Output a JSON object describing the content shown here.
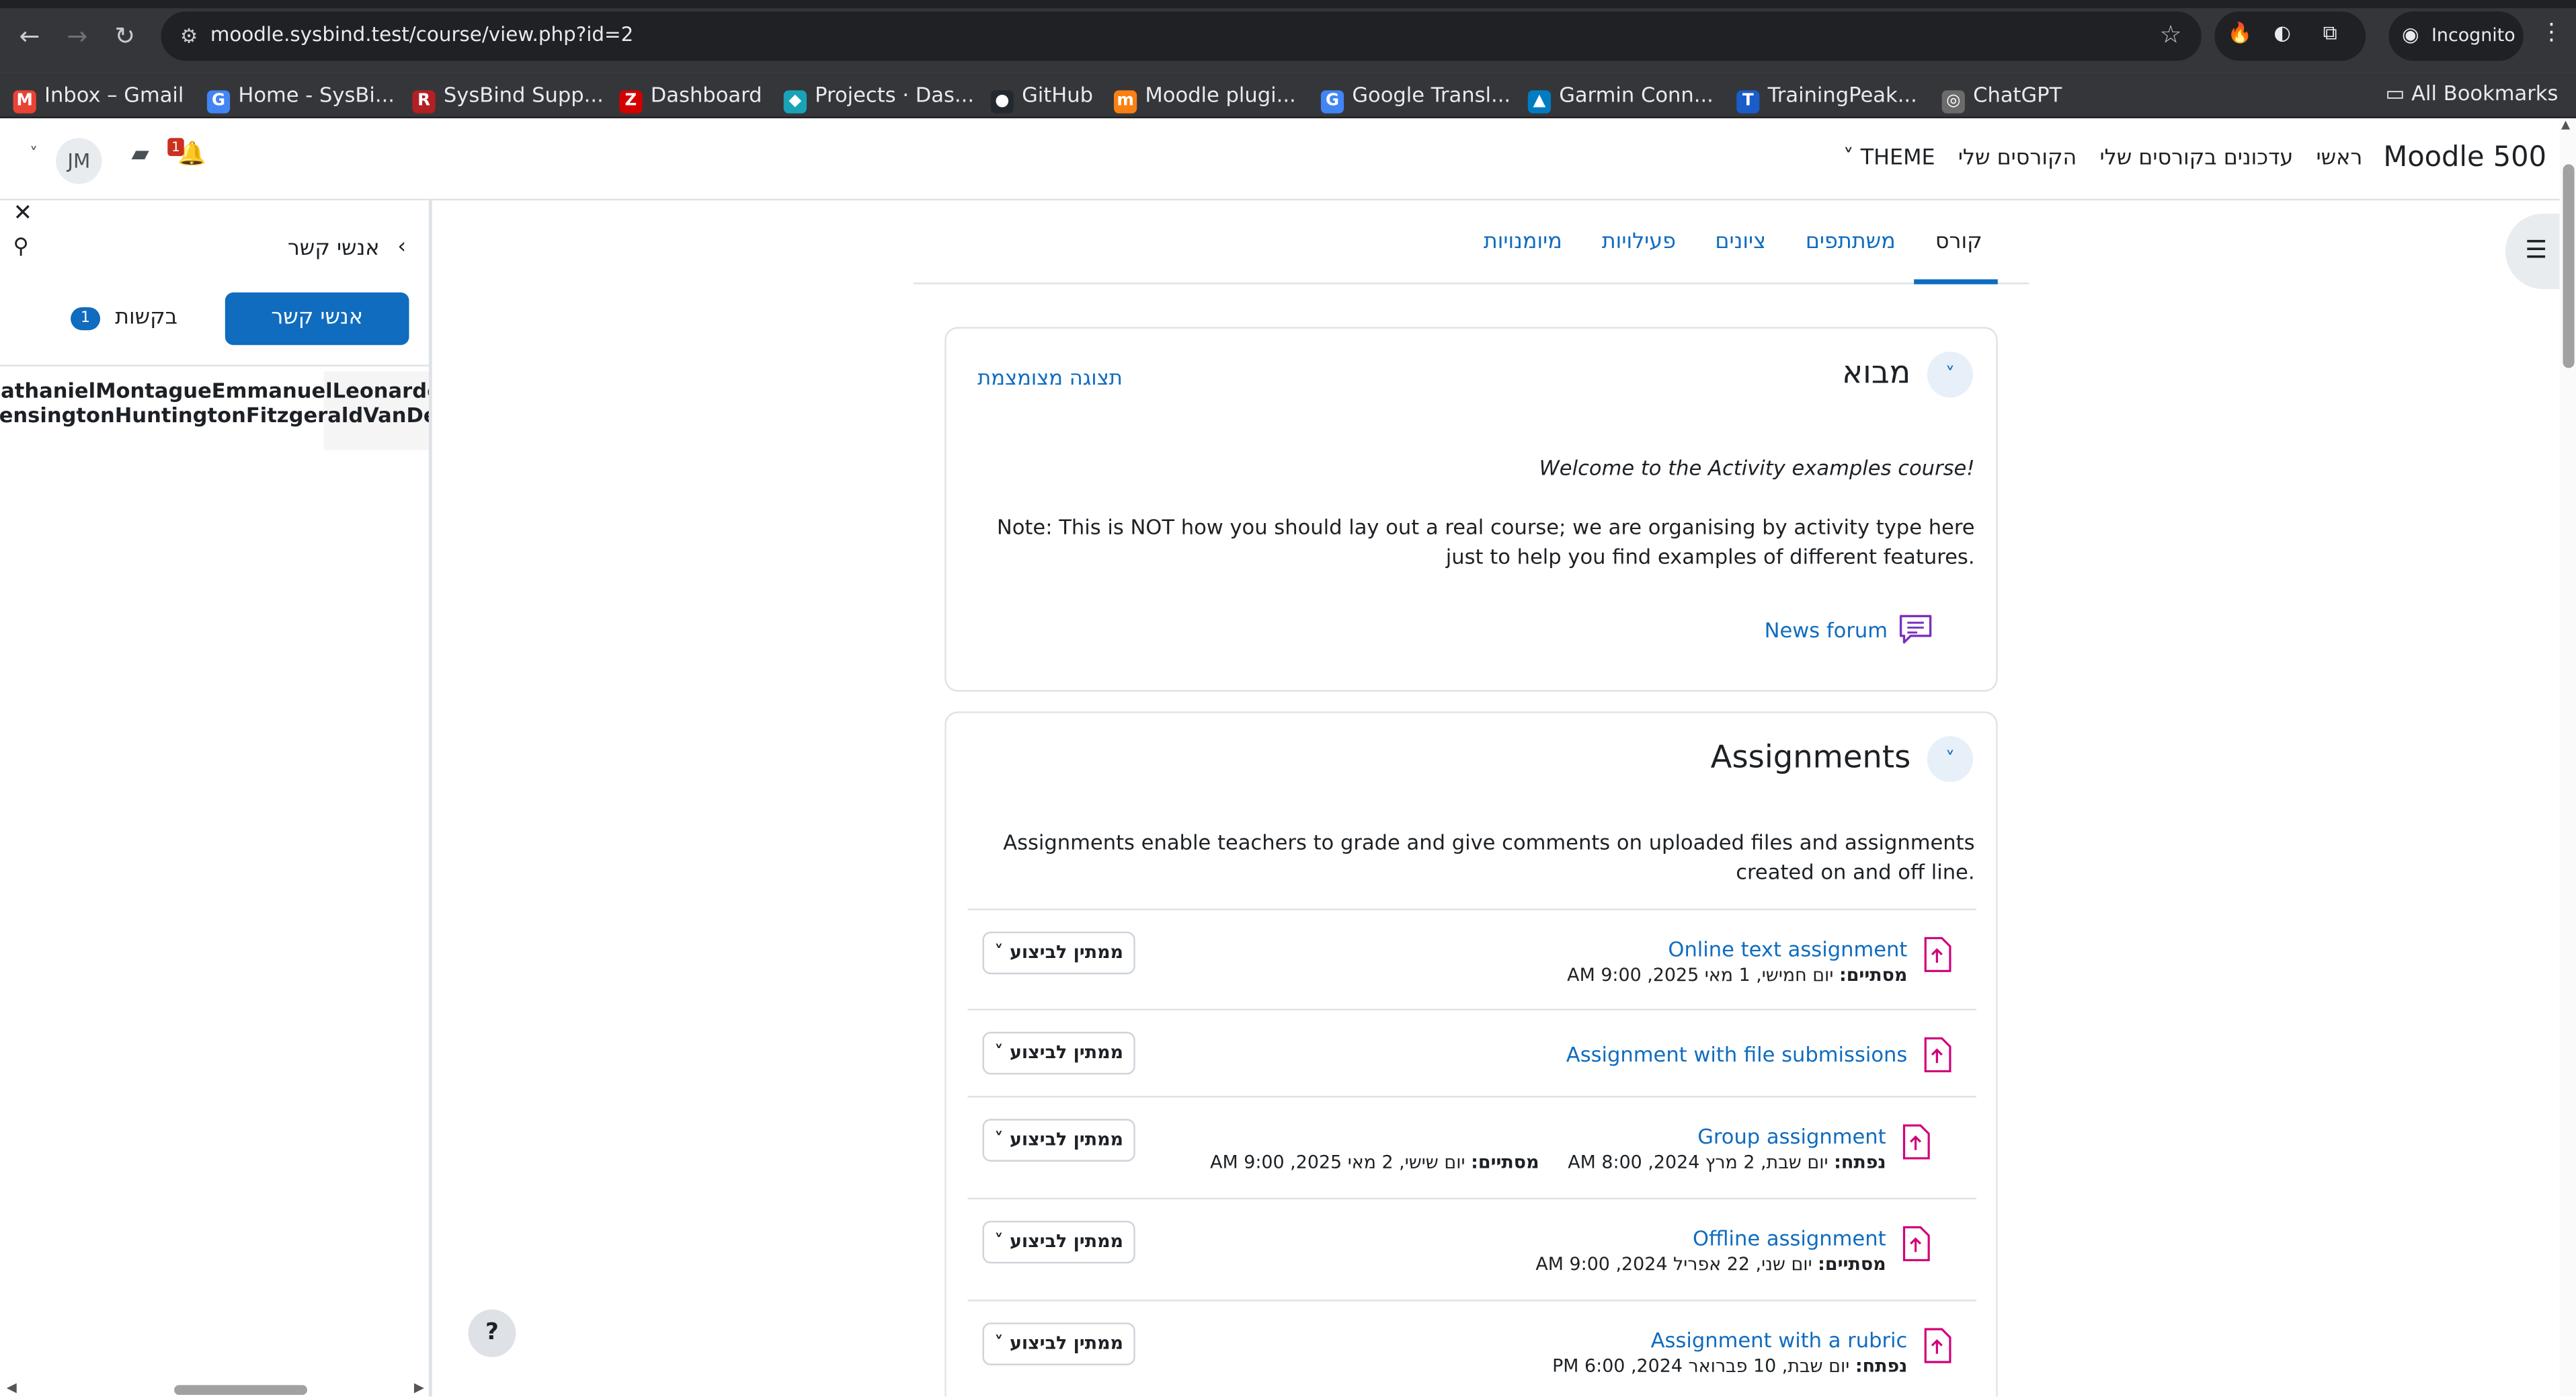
{
  "browser": {
    "url": "moodle.sysbind.test/course/view.php?id=2",
    "incognito_label": "Incognito",
    "bookmarks": [
      {
        "label": "Inbox – Gmail",
        "icon": "gmail-icon",
        "color": "#ea4335",
        "glyph": "M"
      },
      {
        "label": "Home - SysBi...",
        "icon": "google-icon",
        "color": "#4285f4",
        "glyph": "G"
      },
      {
        "label": "SysBind Supp...",
        "icon": "redmine-icon",
        "color": "#b32024",
        "glyph": "R"
      },
      {
        "label": "Dashboard",
        "icon": "zabbix-icon",
        "color": "#d40000",
        "glyph": "Z"
      },
      {
        "label": "Projects · Das...",
        "icon": "gitlab-icon",
        "color": "#1aa3b8",
        "glyph": "◆"
      },
      {
        "label": "GitHub",
        "icon": "github-icon",
        "color": "#24292f",
        "glyph": "●"
      },
      {
        "label": "Moodle plugi...",
        "icon": "moodle-icon",
        "color": "#f98012",
        "glyph": "m"
      },
      {
        "label": "Google Transl...",
        "icon": "google-translate-icon",
        "color": "#4285f4",
        "glyph": "G"
      },
      {
        "label": "Garmin Conn...",
        "icon": "garmin-icon",
        "color": "#007cc3",
        "glyph": "▲"
      },
      {
        "label": "TrainingPeak...",
        "icon": "trainingpeaks-icon",
        "color": "#1a5cc9",
        "glyph": "T"
      },
      {
        "label": "ChatGPT",
        "icon": "chatgpt-icon",
        "color": "#6b6b6b",
        "glyph": "◎"
      }
    ],
    "all_bookmarks_label": "All Bookmarks"
  },
  "navbar": {
    "brand": "Moodle 500",
    "items": [
      "ראשי",
      "עדכונים בקורסים שלי",
      "הקורסים שלי",
      "THEME"
    ],
    "user_initials": "JM",
    "notification_count": "1"
  },
  "drawer": {
    "title": "אנשי קשר",
    "tab_contacts": "אנשי קשר",
    "tab_requests": "בקשות",
    "requests_count": "1",
    "contact_line1": "NathanielMontagueEmmanuelLeonardoFitzw",
    "contact_line2": "KensingtonHuntingtonFitzgeraldVanDerMeer"
  },
  "secondary_nav": {
    "tabs": [
      "קורס",
      "משתתפים",
      "ציונים",
      "פעילויות",
      "מיומנויות"
    ],
    "active": "קורס"
  },
  "sections": {
    "intro": {
      "title": "מבוא",
      "collapse_label": "תצוגה מצומצמת",
      "welcome": "Welcome to the Activity examples course!",
      "note": "Note: This is NOT how you should lay out a real course; we are organising by activity type here just to help you find examples of different features.",
      "forum": "News forum"
    },
    "assignments": {
      "title": "Assignments",
      "summary": "Assignments enable teachers to grade and give comments on uploaded files and assignments created on and off line.",
      "activities": [
        {
          "name": "Online text assignment",
          "dates": [
            {
              "label": "מסתיים:",
              "value": "יום חמישי, 1 מאי 2025, 9:00 AM"
            }
          ],
          "status": "ממתין לביצוע"
        },
        {
          "name": "Assignment with file submissions",
          "dates": [],
          "status": "ממתין לביצוע"
        },
        {
          "name": "Group assignment",
          "dates": [
            {
              "label": "נפתח:",
              "value": "יום שבת, 2 מרץ 2024, 8:00 AM"
            },
            {
              "label": "מסתיים:",
              "value": "יום שישי, 2 מאי 2025, 9:00 AM"
            }
          ],
          "status": "ממתין לביצוע"
        },
        {
          "name": "Offline assignment",
          "dates": [
            {
              "label": "מסתיים:",
              "value": "יום שני, 22 אפריל 2024, 9:00 AM"
            }
          ],
          "status": "ממתין לביצוע"
        },
        {
          "name": "Assignment with a rubric",
          "dates": [
            {
              "label": "נפתח:",
              "value": "יום שבת, 10 פברואר 2024, 6:00 PM"
            }
          ],
          "status": "ממתין לביצוע"
        }
      ]
    }
  },
  "colors": {
    "primary": "#0f6cbf",
    "assign_icon": "#d1007a",
    "forum_icon": "#7b2fbf",
    "badge": "#ca3120"
  }
}
